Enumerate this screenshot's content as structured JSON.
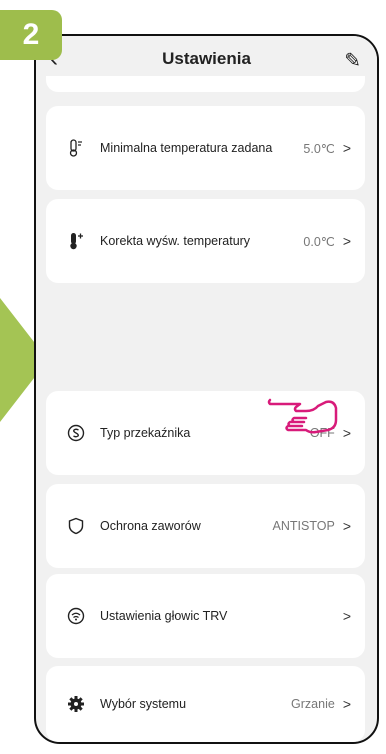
{
  "badge": "2",
  "header": {
    "title": "Ustawienia",
    "back_icon": "chevron-left-icon",
    "edit_icon": "pencil-icon"
  },
  "settings": [
    {
      "icon": "thermometer-outline-icon",
      "label": "Minimalna temperatura zadana",
      "value": "5.0℃",
      "chevron": ">"
    },
    {
      "icon": "thermometer-filled-icon",
      "label": "Korekta wyśw. temperatury",
      "value": "0.0℃",
      "chevron": ">"
    },
    {
      "icon": "relay-icon",
      "label": "Typ przekaźnika",
      "value": "OFF",
      "chevron": ">"
    },
    {
      "icon": "shield-icon",
      "label": "Ochrona zaworów",
      "value": "ANTISTOP",
      "chevron": ">"
    },
    {
      "icon": "trv-head-icon",
      "label": "Ustawienia głowic TRV",
      "value": "",
      "chevron": ">"
    },
    {
      "icon": "gear-icon",
      "label": "Wybór systemu",
      "value": "Grzanie",
      "chevron": ">"
    }
  ],
  "colors": {
    "badge": "#9ebd4c",
    "arrow": "#a4c454",
    "hand": "#d81b7a"
  }
}
